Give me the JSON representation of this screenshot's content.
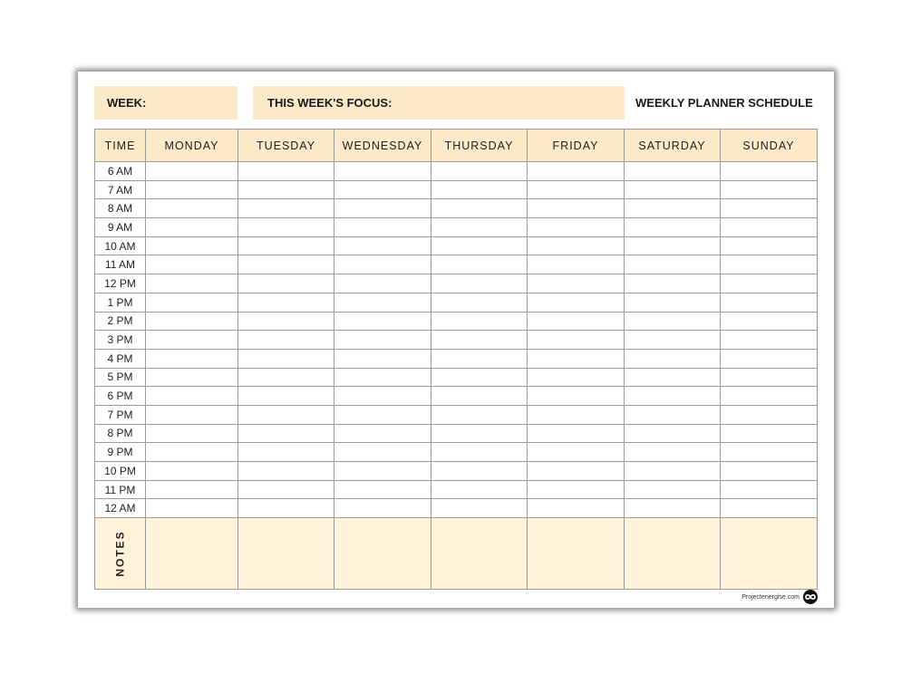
{
  "header": {
    "week_label": "WEEK:",
    "focus_label": "THIS WEEK'S FOCUS:",
    "title": "WEEKLY PLANNER SCHEDULE"
  },
  "columns": {
    "time": "TIME",
    "days": [
      "MONDAY",
      "TUESDAY",
      "WEDNESDAY",
      "THURSDAY",
      "FRIDAY",
      "SATURDAY",
      "SUNDAY"
    ]
  },
  "time_slots": [
    "6 AM",
    "7 AM",
    "8 AM",
    "9 AM",
    "10 AM",
    "11 AM",
    "12 PM",
    "1 PM",
    "2 PM",
    "3 PM",
    "4 PM",
    "5 PM",
    "6 PM",
    "7 PM",
    "8 PM",
    "9 PM",
    "10 PM",
    "11 PM",
    "12 AM"
  ],
  "notes_label": "NOTES",
  "footer": {
    "site": "Projectenergise.com",
    "logo_icon": "infinity-logo-icon"
  },
  "colors": {
    "header_fill": "#fbe9c8",
    "notes_fill": "#fef2d8",
    "grid_line": "#9a9a9a"
  }
}
